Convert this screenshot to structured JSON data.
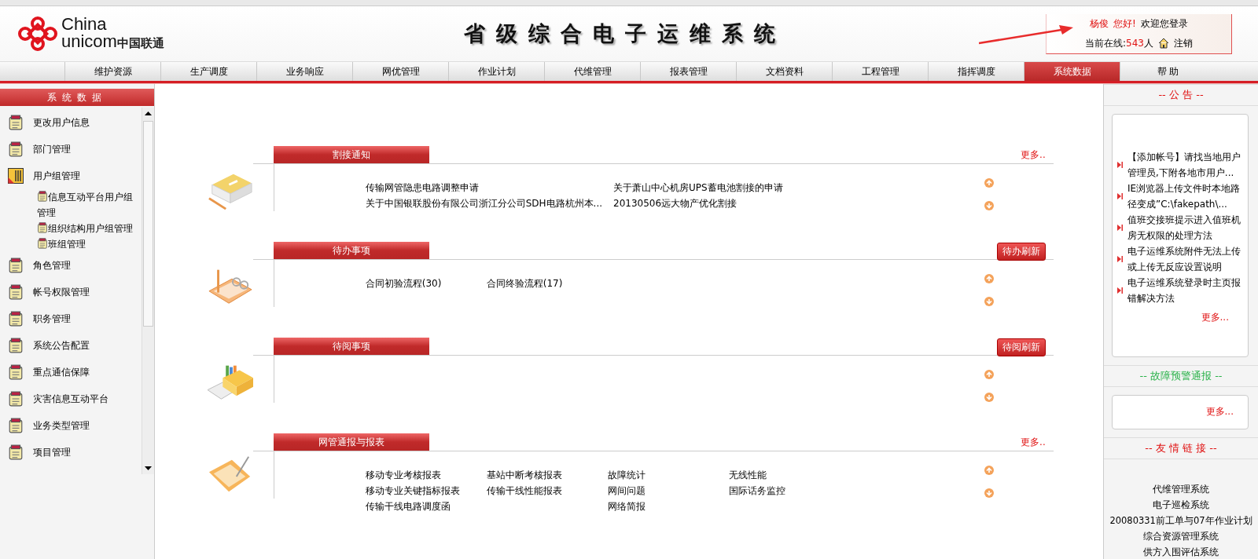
{
  "header": {
    "logo": {
      "line1": "China",
      "line2": "unicom",
      "line2_cn": "中国联通"
    },
    "title": "省级综合电子运维系统",
    "user": {
      "name": "杨俊",
      "greeting": "您好!",
      "welcome": "欢迎您登录",
      "online_label": "当前在线:",
      "online_count": "543",
      "online_unit": "人",
      "logout": "注销"
    }
  },
  "nav": [
    {
      "label": "维护资源",
      "selected": false
    },
    {
      "label": "生产调度",
      "selected": false
    },
    {
      "label": "业务响应",
      "selected": false
    },
    {
      "label": "网优管理",
      "selected": false
    },
    {
      "label": "作业计划",
      "selected": false
    },
    {
      "label": "代维管理",
      "selected": false
    },
    {
      "label": "报表管理",
      "selected": false
    },
    {
      "label": "文档资料",
      "selected": false
    },
    {
      "label": "工程管理",
      "selected": false
    },
    {
      "label": "指挥调度",
      "selected": false
    },
    {
      "label": "系统数据",
      "selected": true
    },
    {
      "label": "帮 助",
      "selected": false
    }
  ],
  "sidebar": {
    "title": "系统数据",
    "items": [
      {
        "label": "更改用户信息",
        "kind": "folder"
      },
      {
        "label": "部门管理",
        "kind": "folder"
      },
      {
        "label": "用户组管理",
        "kind": "open",
        "children": [
          {
            "label": "信息互动平台用户组管理"
          },
          {
            "label": "组织结构用户组管理"
          },
          {
            "label": "班组管理"
          }
        ]
      },
      {
        "label": "角色管理",
        "kind": "folder"
      },
      {
        "label": "帐号权限管理",
        "kind": "folder"
      },
      {
        "label": "职务管理",
        "kind": "folder"
      },
      {
        "label": "系统公告配置",
        "kind": "folder"
      },
      {
        "label": "重点通信保障",
        "kind": "folder"
      },
      {
        "label": "灾害信息互动平台",
        "kind": "folder"
      },
      {
        "label": "业务类型管理",
        "kind": "folder"
      },
      {
        "label": "项目管理",
        "kind": "folder"
      }
    ]
  },
  "sections": [
    {
      "title": "割接通知",
      "kind": "papers",
      "action": {
        "kind": "link",
        "label": "更多.."
      },
      "columns": [
        [
          "传输网管隐患电路调整申请",
          "关于中国银联股份有限公司浙江分公司SDH电路杭州本..."
        ],
        [
          "关于萧山中心机房UPS蓄电池割接的申请",
          "20130506远大物产优化割接"
        ]
      ]
    },
    {
      "title": "待办事项",
      "kind": "notebook",
      "action": {
        "kind": "button",
        "label": "待办刷新"
      },
      "columns": [
        [
          "合同初验流程(30)"
        ],
        [
          "合同终验流程(17)"
        ]
      ]
    },
    {
      "title": "待阅事项",
      "kind": "box",
      "action": {
        "kind": "button",
        "label": "待阅刷新"
      }
    },
    {
      "title": "网管通报与报表",
      "kind": "folder",
      "action": {
        "kind": "link",
        "label": "更多.."
      },
      "columns": [
        [
          "移动专业考核报表",
          "移动专业关键指标报表",
          "传输干线电路调度函"
        ],
        [
          "基站中断考核报表",
          "传输干线性能报表"
        ],
        [
          "故障统计",
          "网间问题",
          "网络简报"
        ],
        [
          "无线性能",
          "国际话务监控"
        ]
      ]
    }
  ],
  "right": {
    "notice": {
      "title": "-- 公 告 --",
      "items": [
        "【添加帐号】请找当地用户管理员,下附各地市用户...",
        "IE浏览器上传文件时本地路径变成”C:\\fakepath\\...",
        "值班交接班提示进入值班机房无权限的处理方法",
        "电子运维系统附件无法上传或上传无反应设置说明",
        "电子运维系统登录时主页报错解决方法"
      ],
      "more": "更多..."
    },
    "alerts": {
      "title": "-- 故障预警通报 --",
      "more": "更多..."
    },
    "links": {
      "title": "-- 友 情 链 接 --",
      "items": [
        "代维管理系统",
        "电子巡检系统",
        "20080331前工单与07年作业计划",
        "综合资源管理系统",
        "供方入围评估系统"
      ]
    }
  }
}
